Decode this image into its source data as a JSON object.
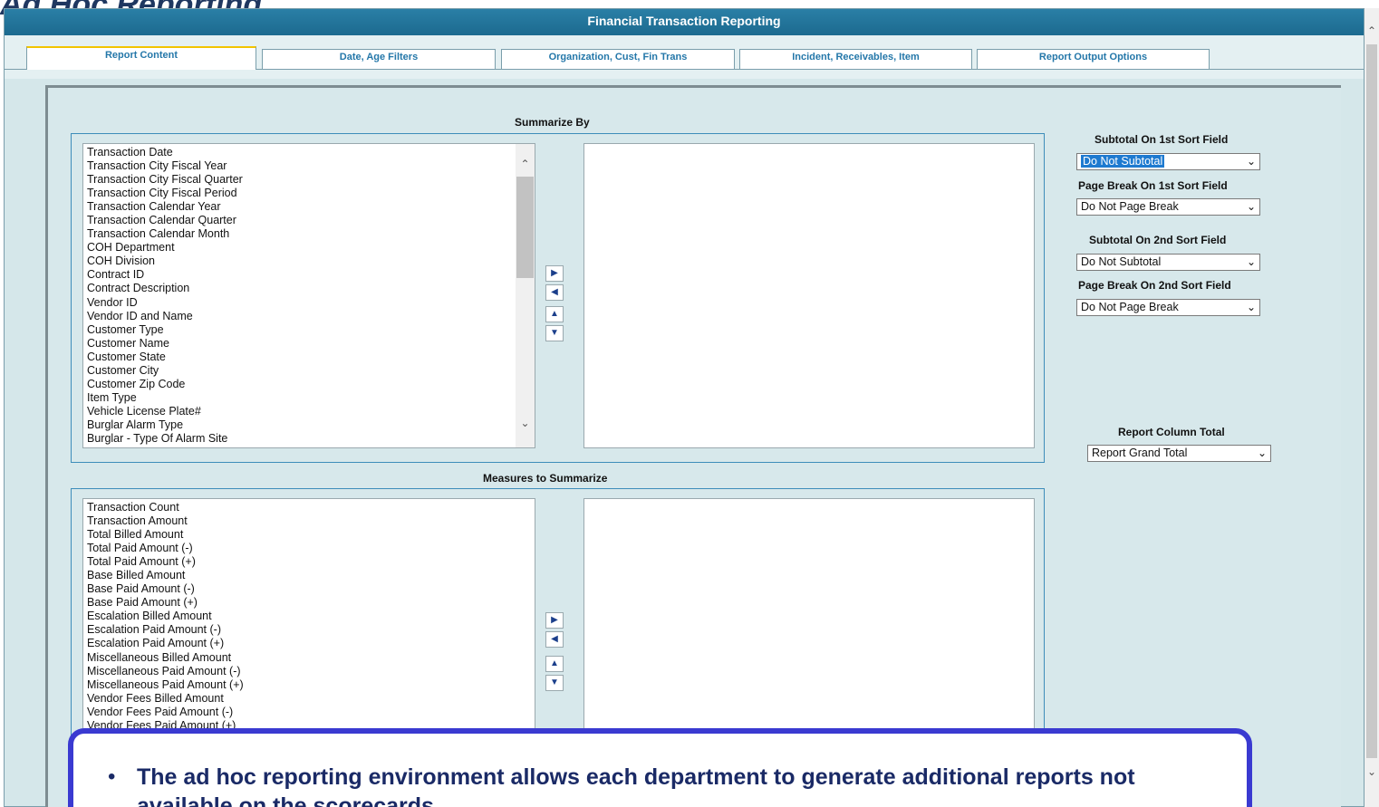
{
  "slide": {
    "title": "Ad Hoc Reporting",
    "callout_text": "The ad hoc reporting environment allows each department to generate additional reports not available on the scorecards"
  },
  "app": {
    "title": "Financial Transaction Reporting",
    "tabs": [
      {
        "label": "Report Content",
        "active": true
      },
      {
        "label": "Date, Age Filters"
      },
      {
        "label": "Organization, Cust, Fin Trans"
      },
      {
        "label": "Incident, Receivables, Item"
      },
      {
        "label": "Report Output Options"
      }
    ]
  },
  "summarize_by": {
    "heading": "Summarize By",
    "available": [
      "Transaction Date",
      "Transaction City Fiscal Year",
      "Transaction City Fiscal Quarter",
      "Transaction City Fiscal Period",
      "Transaction Calendar Year",
      "Transaction Calendar Quarter",
      "Transaction Calendar Month",
      "COH Department",
      "COH Division",
      "Contract ID",
      "Contract Description",
      "Vendor ID",
      "Vendor ID and Name",
      "Customer Type",
      "Customer Name",
      "Customer State",
      "Customer City",
      "Customer Zip Code",
      "Item Type",
      "Vehicle License Plate#",
      "Burglar Alarm Type",
      "Burglar - Type Of Alarm Site"
    ]
  },
  "measures": {
    "heading": "Measures to Summarize",
    "available": [
      "Transaction Count",
      "Transaction Amount",
      "Total Billed Amount",
      "Total Paid Amount (-)",
      "Total Paid Amount (+)",
      "Base Billed Amount",
      "Base Paid Amount (-)",
      "Base Paid Amount (+)",
      "Escalation Billed Amount",
      "Escalation Paid Amount (-)",
      "Escalation Paid Amount (+)",
      "Miscellaneous Billed Amount",
      "Miscellaneous Paid Amount (-)",
      "Miscellaneous Paid Amount (+)",
      "Vendor Fees Billed Amount",
      "Vendor Fees Paid Amount (-)",
      "Vendor Fees Paid Amount (+)"
    ]
  },
  "options": {
    "subtotal_1_label": "Subtotal On 1st Sort Field",
    "subtotal_1_value": "Do Not Subtotal",
    "pagebreak_1_label": "Page Break On 1st Sort Field",
    "pagebreak_1_value": "Do Not Page Break",
    "subtotal_2_label": "Subtotal On 2nd Sort Field",
    "subtotal_2_value": "Do Not Subtotal",
    "pagebreak_2_label": "Page Break On 2nd Sort Field",
    "pagebreak_2_value": "Do Not Page Break",
    "column_total_label": "Report Column Total",
    "column_total_value": "Report Grand Total"
  },
  "icons": {
    "move_right": "arrow-right-icon",
    "move_left": "arrow-left-icon",
    "move_up": "arrow-up-icon",
    "move_down": "arrow-down-icon",
    "dropdown": "chevron-down-icon"
  },
  "colors": {
    "titlebar": "#1c6a8f",
    "tab_text": "#2477a9",
    "callout_border": "#3a3ad1",
    "selection": "#1e7ad0"
  }
}
